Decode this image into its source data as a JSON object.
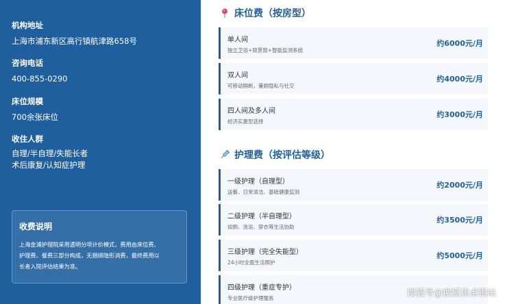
{
  "sidebar": {
    "address": {
      "label": "机构地址",
      "value": "上海市浦东新区高行镇航津路658号"
    },
    "phone": {
      "label": "咨询电话",
      "value": "400-855-0290"
    },
    "beds": {
      "label": "床位规模",
      "value": "700余张床位"
    },
    "residents": {
      "label": "收住人群",
      "line1": "自理/半自理/失能长者",
      "line2": "术后康复/认知症护理"
    },
    "note": {
      "title": "收费说明",
      "line1": "上海金浦护理院采用透明分项计价模式，费用由床位费、",
      "line2": "护理费、餐费三部分构成，无捆绑隐形消费，最终费用以",
      "line3": "长者入院评估结果为准。"
    }
  },
  "bed_section": {
    "title": "床位费（按房型）",
    "icon": "pin-icon",
    "items": [
      {
        "name": "单人间",
        "desc": "独立卫浴+观景窗+智能监测系统",
        "price": "约6000元/月"
      },
      {
        "name": "双人间",
        "desc": "可移动隔断，兼顾隐私与社交",
        "price": "约4000元/月"
      },
      {
        "name": "四人间及多人间",
        "desc": "经济实惠型选择",
        "price": "约3000元/月"
      }
    ]
  },
  "care_section": {
    "title": "护理费（按评估等级）",
    "icon": "syringe-icon",
    "items": [
      {
        "name": "一级护理（自理型）",
        "desc": "送餐、日常清洁、基础健康监测",
        "price": "约2000元/月"
      },
      {
        "name": "二级护理（半自理型）",
        "desc": "如厕、洗浴、穿衣等生活协助",
        "price": "约3500元/月"
      },
      {
        "name": "三级护理（完全失能型）",
        "desc": "24小时全面生活照护",
        "price": "约5000元/月"
      },
      {
        "name": "四级护理（重症专护）",
        "desc": "专业医疗级护理服务",
        "price": ""
      }
    ]
  },
  "watermark": "搜狐号@搜狐焦点银站",
  "colors": {
    "sidebar_bg": "#1f5f9e",
    "accent": "#1f5f9e",
    "card_bg": "#f4f8fc"
  }
}
